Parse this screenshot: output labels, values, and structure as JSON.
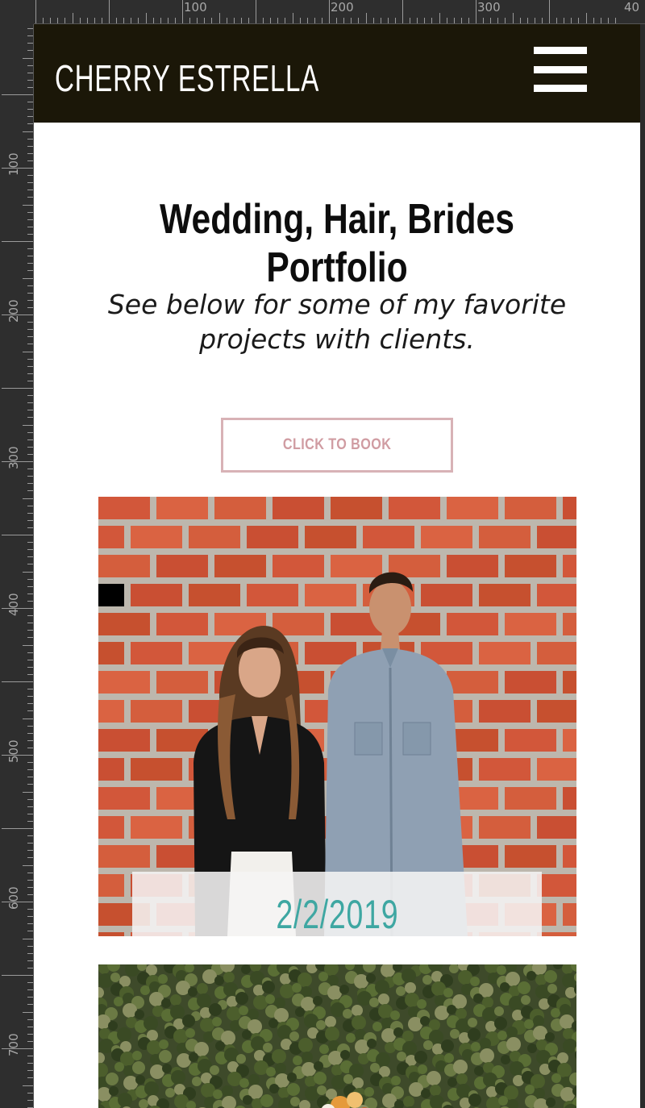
{
  "site": {
    "logo_text": "CHERRY ESTRELLA",
    "menu_icon": "hamburger-menu-icon"
  },
  "main": {
    "title": "Wedding, Hair, Brides Portfolio",
    "subtitle": "See below for some of my favorite projects with clients.",
    "cta_label": "CLICK TO BOOK"
  },
  "gallery": {
    "items": [
      {
        "date": "2/2/2019"
      },
      {
        "date": ""
      }
    ]
  },
  "rulers": {
    "top_labels": [
      "100",
      "200",
      "300",
      "40"
    ],
    "left_labels": [
      "100",
      "200",
      "300",
      "400",
      "500",
      "600",
      "700"
    ]
  },
  "colors": {
    "header_bg": "#1b1708",
    "cta_border": "#d8b2b6",
    "cta_text": "#d09ca2",
    "date_text": "#3ea7a2"
  }
}
